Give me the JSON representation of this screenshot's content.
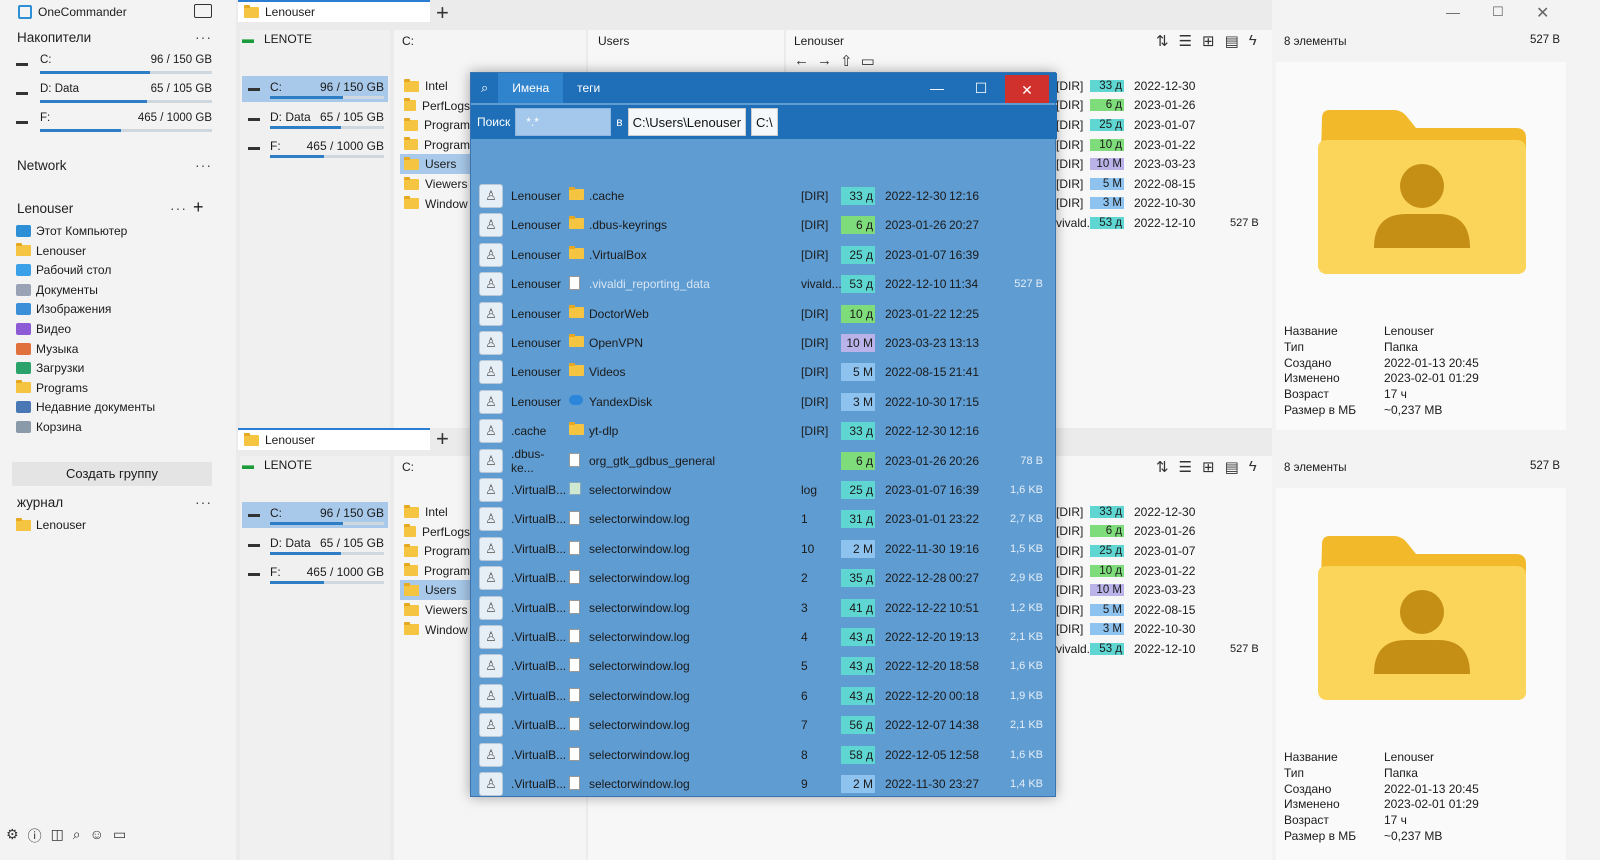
{
  "app": {
    "title": "OneCommander"
  },
  "sidebar": {
    "drives_header": "Накопители",
    "drives": [
      {
        "label": "C:",
        "size": "96 / 150 GB",
        "fill": 0.64
      },
      {
        "label": "D:  Data",
        "size": "65 / 105 GB",
        "fill": 0.62
      },
      {
        "label": "F:",
        "size": "465 / 1000 GB",
        "fill": 0.47
      }
    ],
    "network": "Network",
    "user_header": "Lenouser",
    "quick": [
      {
        "label": "Этот Компьютер",
        "icon": "computer-icon",
        "color": "#2d8fd5"
      },
      {
        "label": "Lenouser",
        "icon": "folder-icon",
        "color": "#f5c542"
      },
      {
        "label": "Рабочий стол",
        "icon": "desktop-icon",
        "color": "#3aa0e8"
      },
      {
        "label": "Документы",
        "icon": "documents-icon",
        "color": "#9aa3b5"
      },
      {
        "label": "Изображения",
        "icon": "pictures-icon",
        "color": "#3a8fd8"
      },
      {
        "label": "Видео",
        "icon": "video-icon",
        "color": "#8e5bd6"
      },
      {
        "label": "Музыка",
        "icon": "music-icon",
        "color": "#e0713d"
      },
      {
        "label": "Загрузки",
        "icon": "downloads-icon",
        "color": "#2aa36b"
      },
      {
        "label": "Programs",
        "icon": "folder-icon",
        "color": "#f5c542"
      },
      {
        "label": "Недавние документы",
        "icon": "recent-icon",
        "color": "#4a78b5"
      },
      {
        "label": "Корзина",
        "icon": "recycle-bin-icon",
        "color": "#8a9aa8"
      }
    ],
    "create_group": "Создать группу",
    "journal": "журнал",
    "journal_items": [
      "Lenouser"
    ]
  },
  "top_pane": {
    "tab": "Lenouser",
    "computer": "LENOTE",
    "col2": "C:",
    "col3": "Users",
    "col4": "Lenouser",
    "count": "8 элементы",
    "total": "527 B"
  },
  "bottom_pane": {
    "tab": "Lenouser",
    "computer": "LENOTE",
    "col2": "C:",
    "count": "8 элементы",
    "total": "527 B"
  },
  "drives_panel": [
    {
      "label": "C:",
      "size": "96 / 150 GB",
      "fill": 0.64
    },
    {
      "label": "D:  Data",
      "size": "65 / 105 GB",
      "fill": 0.62
    },
    {
      "label": "F:",
      "size": "465 / 1000 GB",
      "fill": 0.47
    }
  ],
  "c_folders": [
    "Intel",
    "PerfLogs",
    "Program",
    "Program",
    "Users",
    "Viewers",
    "Window"
  ],
  "right_list": [
    {
      "name": "[DIR]",
      "age": "33 д",
      "age_color": "#5fd6d2",
      "date": "2022-12-30",
      "size": ""
    },
    {
      "name": "[DIR]",
      "age": "6 д",
      "age_color": "#7fdc7a",
      "date": "2023-01-26",
      "size": ""
    },
    {
      "name": "[DIR]",
      "age": "25 д",
      "age_color": "#5fd6d2",
      "date": "2023-01-07",
      "size": ""
    },
    {
      "name": "[DIR]",
      "age": "10 д",
      "age_color": "#7fdc7a",
      "date": "2023-01-22",
      "size": ""
    },
    {
      "name": "[DIR]",
      "age": "10 M",
      "age_color": "#b9b3ea",
      "date": "2023-03-23",
      "size": ""
    },
    {
      "name": "[DIR]",
      "age": "5 M",
      "age_color": "#8ec3f0",
      "date": "2022-08-15",
      "size": ""
    },
    {
      "name": "[DIR]",
      "age": "3 M",
      "age_color": "#8ec3f0",
      "date": "2022-10-30",
      "size": ""
    },
    {
      "name": "vivald...",
      "age": "53 д",
      "age_color": "#5fd6d2",
      "date": "2022-12-10",
      "size": "527 B"
    }
  ],
  "props": {
    "labels": [
      "Название",
      "Тип",
      "Создано",
      "Изменено",
      "Возраст",
      "Размер в МБ"
    ],
    "values": [
      "Lenouser",
      "Папка",
      "2022-01-13  20:45",
      "2023-02-01  01:29",
      "17 ч",
      "~0,237 MB"
    ]
  },
  "dialog": {
    "tabs": [
      "Имена",
      "теги"
    ],
    "search_label": "Поиск",
    "search_value": "*.*",
    "in_label": "в",
    "path": "C:\\Users\\Lenouser",
    "root": "C:\\",
    "rows": [
      {
        "owner": "Lenouser",
        "icon": "folder",
        "name": ".cache",
        "ext": "[DIR]",
        "age": "33 д",
        "color": "#5fd6d2",
        "date": "2022-12-30",
        "time": "12:16",
        "size": ""
      },
      {
        "owner": "Lenouser",
        "icon": "folder",
        "name": ".dbus-keyrings",
        "ext": "[DIR]",
        "age": "6 д",
        "color": "#7fdc7a",
        "date": "2023-01-26",
        "time": "20:27",
        "size": ""
      },
      {
        "owner": "Lenouser",
        "icon": "folder",
        "name": ".VirtualBox",
        "ext": "[DIR]",
        "age": "25 д",
        "color": "#5fd6d2",
        "date": "2023-01-07",
        "time": "16:39",
        "size": ""
      },
      {
        "owner": "Lenouser",
        "icon": "doc",
        "name": ".vivaldi_reporting_data",
        "ext": "vivald...",
        "age": "53 д",
        "color": "#5fd6d2",
        "date": "2022-12-10",
        "time": "11:34",
        "size": "527 B",
        "dim": true
      },
      {
        "owner": "Lenouser",
        "icon": "folder",
        "name": "DoctorWeb",
        "ext": "[DIR]",
        "age": "10 д",
        "color": "#7fdc7a",
        "date": "2023-01-22",
        "time": "12:25",
        "size": ""
      },
      {
        "owner": "Lenouser",
        "icon": "folder",
        "name": "OpenVPN",
        "ext": "[DIR]",
        "age": "10 M",
        "color": "#b9b3ea",
        "date": "2023-03-23",
        "time": "13:13",
        "size": ""
      },
      {
        "owner": "Lenouser",
        "icon": "folder",
        "name": "Videos",
        "ext": "[DIR]",
        "age": "5 M",
        "color": "#8ec3f0",
        "date": "2022-08-15",
        "time": "21:41",
        "size": ""
      },
      {
        "owner": "Lenouser",
        "icon": "yandex",
        "name": "YandexDisk",
        "ext": "[DIR]",
        "age": "3 M",
        "color": "#8ec3f0",
        "date": "2022-10-30",
        "time": "17:15",
        "size": ""
      },
      {
        "owner": ".cache",
        "icon": "folder",
        "name": "yt-dlp",
        "ext": "[DIR]",
        "age": "33 д",
        "color": "#5fd6d2",
        "date": "2022-12-30",
        "time": "12:16",
        "size": ""
      },
      {
        "owner": ".dbus-ke...",
        "icon": "doc",
        "name": "org_gtk_gdbus_general",
        "ext": "",
        "age": "6 д",
        "color": "#7fdc7a",
        "date": "2023-01-26",
        "time": "20:26",
        "size": "78 B"
      },
      {
        "owner": ".VirtualB...",
        "icon": "log",
        "name": "selectorwindow",
        "ext": "log",
        "age": "25 д",
        "color": "#5fd6d2",
        "date": "2023-01-07",
        "time": "16:39",
        "size": "1,6 KB"
      },
      {
        "owner": ".VirtualB...",
        "icon": "doc",
        "name": "selectorwindow.log",
        "ext": "1",
        "age": "31 д",
        "color": "#5fd6d2",
        "date": "2023-01-01",
        "time": "23:22",
        "size": "2,7 KB"
      },
      {
        "owner": ".VirtualB...",
        "icon": "doc",
        "name": "selectorwindow.log",
        "ext": "10",
        "age": "2 M",
        "color": "#8ec3f0",
        "date": "2022-11-30",
        "time": "19:16",
        "size": "1,5 KB"
      },
      {
        "owner": ".VirtualB...",
        "icon": "doc",
        "name": "selectorwindow.log",
        "ext": "2",
        "age": "35 д",
        "color": "#5fd6d2",
        "date": "2022-12-28",
        "time": "00:27",
        "size": "2,9 KB"
      },
      {
        "owner": ".VirtualB...",
        "icon": "doc",
        "name": "selectorwindow.log",
        "ext": "3",
        "age": "41 д",
        "color": "#5fd6d2",
        "date": "2022-12-22",
        "time": "10:51",
        "size": "1,2 KB"
      },
      {
        "owner": ".VirtualB...",
        "icon": "doc",
        "name": "selectorwindow.log",
        "ext": "4",
        "age": "43 д",
        "color": "#5fd6d2",
        "date": "2022-12-20",
        "time": "19:13",
        "size": "2,1 KB"
      },
      {
        "owner": ".VirtualB...",
        "icon": "doc",
        "name": "selectorwindow.log",
        "ext": "5",
        "age": "43 д",
        "color": "#5fd6d2",
        "date": "2022-12-20",
        "time": "18:58",
        "size": "1,6 KB"
      },
      {
        "owner": ".VirtualB...",
        "icon": "doc",
        "name": "selectorwindow.log",
        "ext": "6",
        "age": "43 д",
        "color": "#5fd6d2",
        "date": "2022-12-20",
        "time": "00:18",
        "size": "1,9 KB"
      },
      {
        "owner": ".VirtualB...",
        "icon": "doc",
        "name": "selectorwindow.log",
        "ext": "7",
        "age": "56 д",
        "color": "#5fd6d2",
        "date": "2022-12-07",
        "time": "14:38",
        "size": "2,1 KB"
      },
      {
        "owner": ".VirtualB...",
        "icon": "doc",
        "name": "selectorwindow.log",
        "ext": "8",
        "age": "58 д",
        "color": "#5fd6d2",
        "date": "2022-12-05",
        "time": "12:58",
        "size": "1,6 KB"
      },
      {
        "owner": ".VirtualB...",
        "icon": "doc",
        "name": "selectorwindow.log",
        "ext": "9",
        "age": "2 M",
        "color": "#8ec3f0",
        "date": "2022-11-30",
        "time": "23:27",
        "size": "1,4 KB"
      }
    ]
  }
}
